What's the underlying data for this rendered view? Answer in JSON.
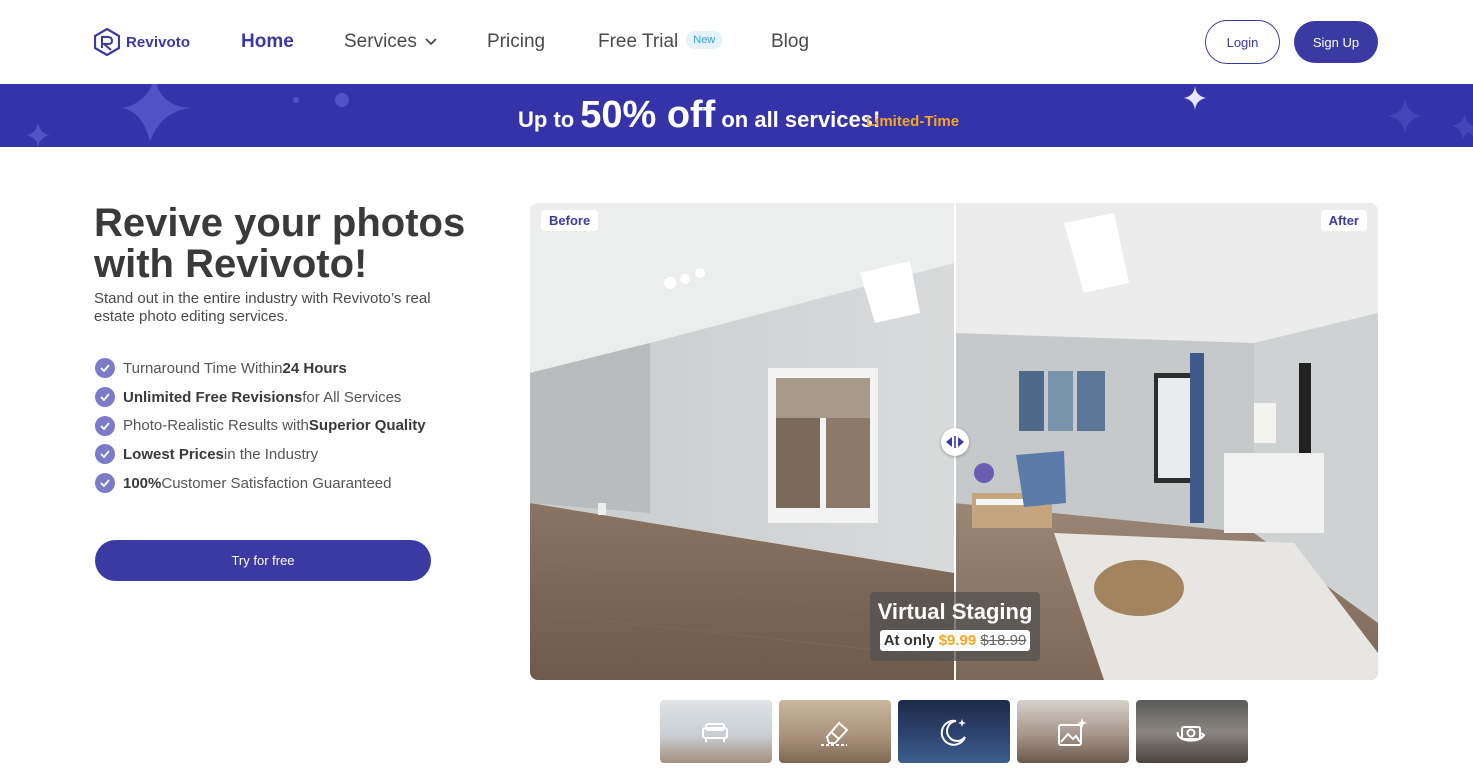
{
  "brand": {
    "name": "Revivoto",
    "accent": "#3b3aa3"
  },
  "nav": {
    "items": [
      {
        "label": "Home"
      },
      {
        "label": "Services"
      },
      {
        "label": "Pricing"
      },
      {
        "label": "Free Trial",
        "badge": "New"
      },
      {
        "label": "Blog"
      }
    ],
    "login": "Login",
    "signup": "Sign Up"
  },
  "banner": {
    "prefix": "Up to",
    "highlight": "50% off",
    "suffix": "on all services!",
    "tag": "Limited-Time"
  },
  "hero": {
    "title": "Revive your photos with Revivoto!",
    "subtitle": "Stand out in the entire industry with Revivoto’s real estate photo editing services.",
    "features": [
      {
        "pre": "Turnaround Time Within ",
        "bold": "24 Hours",
        "post": ""
      },
      {
        "pre": "",
        "bold": "Unlimited Free Revisions",
        "post": " for All Services"
      },
      {
        "pre": "Photo-Realistic Results with ",
        "bold": "Superior Quality",
        "post": ""
      },
      {
        "pre": "",
        "bold": "Lowest Prices",
        "post": " in the Industry"
      },
      {
        "pre": "",
        "bold": "100%",
        "post": " Customer Satisfaction Guaranteed"
      }
    ],
    "cta": "Try for free"
  },
  "compare": {
    "before_label": "Before",
    "after_label": "After",
    "service": "Virtual Staging",
    "price_prefix": "At only",
    "price": "$9.99",
    "old_price": "$18.99"
  },
  "thumbnails": [
    {
      "icon": "sofa-icon"
    },
    {
      "icon": "eraser-icon"
    },
    {
      "icon": "moon-icon"
    },
    {
      "icon": "image-sparkle-icon"
    },
    {
      "icon": "camera-360-icon"
    }
  ]
}
